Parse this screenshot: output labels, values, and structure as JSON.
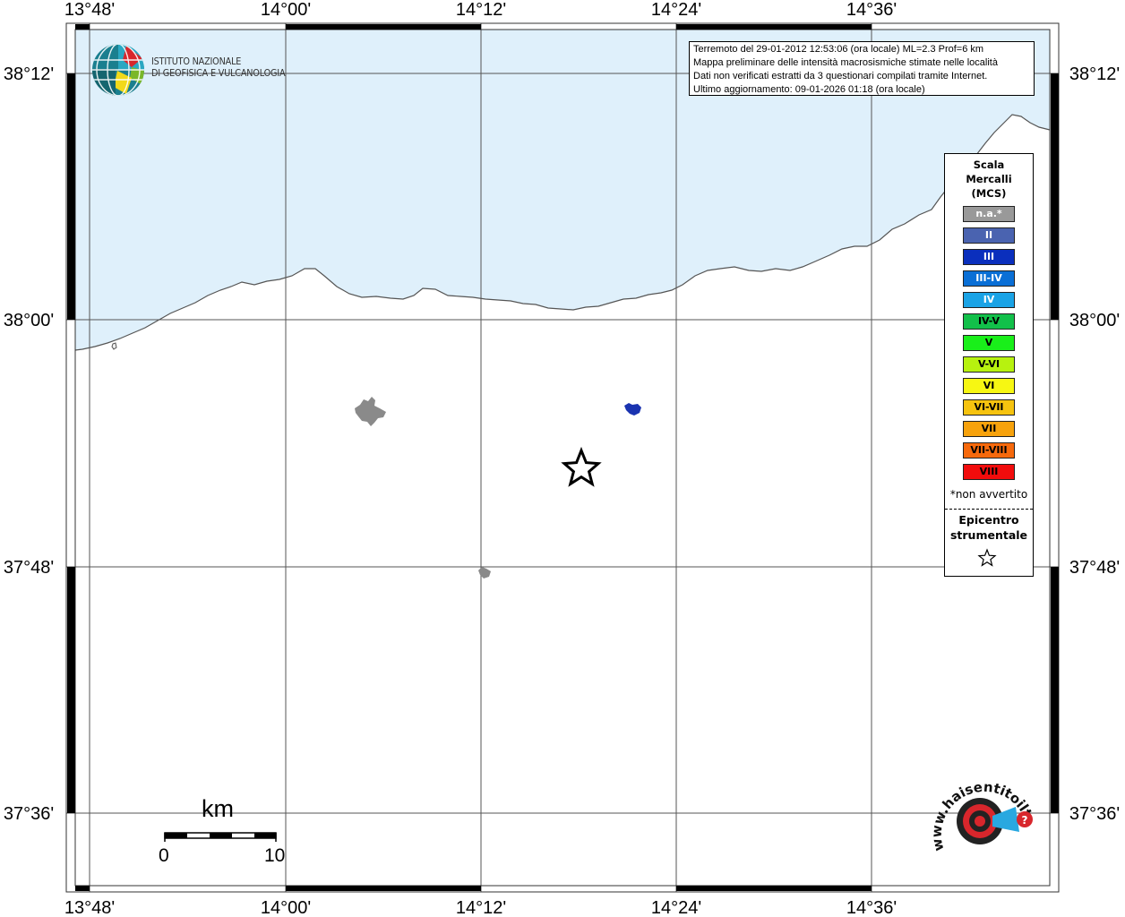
{
  "info_box": {
    "lines": [
      "Terremoto del 29-01-2012 12:53:06 (ora locale) ML=2.3 Prof=6 km",
      "Mappa preliminare delle intensità macrosismiche stimate nelle località",
      "Dati non verificati estratti da 3 questionari compilati tramite Internet.",
      "Ultimo aggiornamento: 09-01-2026 01:18 (ora locale)"
    ]
  },
  "logo": {
    "line1": "ISTITUTO NAZIONALE",
    "line2": "DI GEOFISICA E VULCANOLOGIA"
  },
  "axes": {
    "longitudes": [
      "13°48'",
      "14°00'",
      "14°12'",
      "14°24'",
      "14°36'"
    ],
    "latitudes": [
      "38°12'",
      "38°00'",
      "37°48'",
      "37°36'"
    ]
  },
  "legend": {
    "title_lines": [
      "Scala",
      "Mercalli",
      "(MCS)"
    ],
    "items": [
      {
        "label": "n.a.*",
        "color": "#999999",
        "text_color": "#ffffff"
      },
      {
        "label": "II",
        "color": "#4a63b0",
        "text_color": "#ffffff"
      },
      {
        "label": "III",
        "color": "#0a2fbd",
        "text_color": "#ffffff"
      },
      {
        "label": "III-IV",
        "color": "#0a6fd6",
        "text_color": "#ffffff"
      },
      {
        "label": "IV",
        "color": "#1aa3e6",
        "text_color": "#ffffff"
      },
      {
        "label": "IV-V",
        "color": "#12c04a",
        "text_color": "#000000"
      },
      {
        "label": "V",
        "color": "#19ef1a",
        "text_color": "#000000"
      },
      {
        "label": "V-VI",
        "color": "#b7f20f",
        "text_color": "#000000"
      },
      {
        "label": "VI",
        "color": "#f7f712",
        "text_color": "#000000"
      },
      {
        "label": "VI-VII",
        "color": "#f6c30f",
        "text_color": "#000000"
      },
      {
        "label": "VII",
        "color": "#f7a20c",
        "text_color": "#000000"
      },
      {
        "label": "VII-VIII",
        "color": "#f6690c",
        "text_color": "#000000"
      },
      {
        "label": "VIII",
        "color": "#f20c0c",
        "text_color": "#000000"
      }
    ],
    "footnote": "*non avvertito",
    "epicenter_lines": [
      "Epicentro",
      "strumentale"
    ]
  },
  "scale_bar": {
    "unit": "km",
    "start": "0",
    "end": "10"
  },
  "watermark": {
    "text": "www.haisentitoilterremoto.it"
  },
  "colors": {
    "sea": "#dff0fb",
    "land": "#ffffff",
    "coast": "#555555",
    "town_gray": "#8a8a8a",
    "town_blue": "#1a33b0"
  }
}
